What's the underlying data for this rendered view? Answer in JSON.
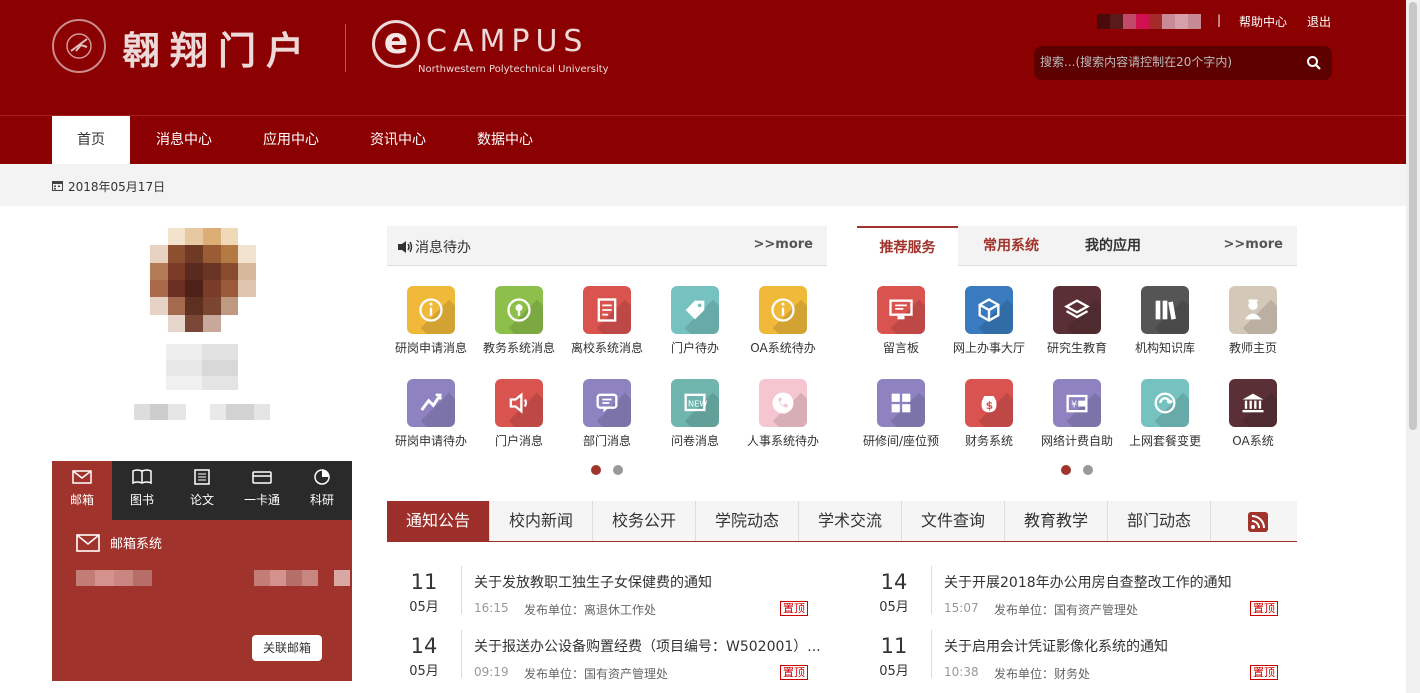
{
  "header": {
    "portal_name": "翱翔门户",
    "brand_word": "CAMPUS",
    "brand_sub": "Northwestern Polytechnical University",
    "user_mosaic_colors": [
      "#4a0a0a",
      "#5a1a1a",
      "#c14a6a",
      "#d01050",
      "#a52a2a",
      "#c88a96",
      "#d6a0aa",
      "#c58a94"
    ],
    "separator": "|",
    "help_label": "帮助中心",
    "logout_label": "退出",
    "search_placeholder": "搜索...(搜索内容请控制在20个字内)"
  },
  "nav": {
    "items": [
      {
        "label": "首页"
      },
      {
        "label": "消息中心"
      },
      {
        "label": "应用中心"
      },
      {
        "label": "资讯中心"
      },
      {
        "label": "数据中心"
      }
    ]
  },
  "datebar": {
    "date": "2018年05月17日"
  },
  "profile": {
    "avatar_colors": [
      "#fff",
      "#f3e2cc",
      "#e8c8a0",
      "#dcae75",
      "#f0d9b8",
      "#fff",
      "#e9d3c0",
      "#8c5030",
      "#6e3a24",
      "#9a5c34",
      "#b47a44",
      "#f2e3d0",
      "#b37a56",
      "#7a3a26",
      "#5a2a1e",
      "#6a3424",
      "#8a4a2e",
      "#d8b89a",
      "#a9694a",
      "#6b2e22",
      "#4d2018",
      "#7a3c28",
      "#9a5a3a",
      "#e0c6b0",
      "#e6d3c5",
      "#a46a50",
      "#5e3020",
      "#7a4630",
      "#c09a80",
      "#fff",
      "#fff",
      "#e6d6cc",
      "#7a4636",
      "#c8a89a",
      "#fff",
      "#fff"
    ]
  },
  "mailbox": {
    "tabs": [
      {
        "label": "邮箱",
        "icon": "mail-icon"
      },
      {
        "label": "图书",
        "icon": "book-icon"
      },
      {
        "label": "论文",
        "icon": "paper-icon"
      },
      {
        "label": "一卡通",
        "icon": "card-icon"
      },
      {
        "label": "科研",
        "icon": "pie-icon"
      }
    ],
    "title": "邮箱系统",
    "link_button": "关联邮箱"
  },
  "messages": {
    "title": "消息待办",
    "more": ">>more",
    "items": [
      {
        "label": "研岗申请消息",
        "color": "#f0b93a",
        "icon": "info-icon"
      },
      {
        "label": "教务系统消息",
        "color": "#8cc04a",
        "icon": "pin-icon"
      },
      {
        "label": "离校系统消息",
        "color": "#d9534f",
        "icon": "doc-icon"
      },
      {
        "label": "门户待办",
        "color": "#76c2c0",
        "icon": "tag-icon"
      },
      {
        "label": "OA系统待办",
        "color": "#f0b93a",
        "icon": "info-icon"
      },
      {
        "label": "研岗申请待办",
        "color": "#8e83c0",
        "icon": "share-icon"
      },
      {
        "label": "门户消息",
        "color": "#d9534f",
        "icon": "speaker-icon"
      },
      {
        "label": "部门消息",
        "color": "#8e83c0",
        "icon": "chat-icon"
      },
      {
        "label": "问卷消息",
        "color": "#6fb5ae",
        "icon": "new-icon"
      },
      {
        "label": "人事系统待办",
        "color": "#f5c6cf",
        "icon": "phone-icon"
      }
    ]
  },
  "services": {
    "tabs": [
      "推荐服务",
      "常用系统",
      "我的应用"
    ],
    "more": ">>more",
    "items": [
      {
        "label": "留言板",
        "color": "#d9534f",
        "icon": "monitor-icon"
      },
      {
        "label": "网上办事大厅",
        "color": "#3a7bbf",
        "icon": "cube-icon"
      },
      {
        "label": "研究生教育",
        "color": "#5a3036",
        "icon": "layers-icon"
      },
      {
        "label": "机构知识库",
        "color": "#555555",
        "icon": "library-icon"
      },
      {
        "label": "教师主页",
        "color": "#d4c8b8",
        "icon": "teacher-icon"
      },
      {
        "label": "研修间/座位预",
        "color": "#8e83c0",
        "icon": "grid-icon"
      },
      {
        "label": "财务系统",
        "color": "#d9534f",
        "icon": "money-icon"
      },
      {
        "label": "网络计费自助",
        "color": "#8e83c0",
        "icon": "wallet-icon"
      },
      {
        "label": "上网套餐变更",
        "color": "#76c2c0",
        "icon": "cycle-icon"
      },
      {
        "label": "OA系统",
        "color": "#5a3036",
        "icon": "bank-icon"
      }
    ]
  },
  "news_tabs": [
    "通知公告",
    "校内新闻",
    "校务公开",
    "学院动态",
    "学术交流",
    "文件查询",
    "教育教学",
    "部门动态"
  ],
  "news": [
    {
      "day": "11",
      "month": "05月",
      "title": "关于发放教职工独生子女保健费的通知",
      "time": "16:15",
      "unit": "发布单位：离退休工作处",
      "badge": "置顶"
    },
    {
      "day": "14",
      "month": "05月",
      "title": "关于开展2018年办公用房自查整改工作的通知",
      "time": "15:07",
      "unit": "发布单位：国有资产管理处",
      "badge": "置顶"
    },
    {
      "day": "14",
      "month": "05月",
      "title": "关于报送办公设备购置经费（项目编号：W502001）...",
      "time": "09:19",
      "unit": "发布单位：国有资产管理处",
      "badge": "置顶"
    },
    {
      "day": "11",
      "month": "05月",
      "title": "关于启用会计凭证影像化系统的通知",
      "time": "10:38",
      "unit": "发布单位：财务处",
      "badge": "置顶"
    }
  ]
}
